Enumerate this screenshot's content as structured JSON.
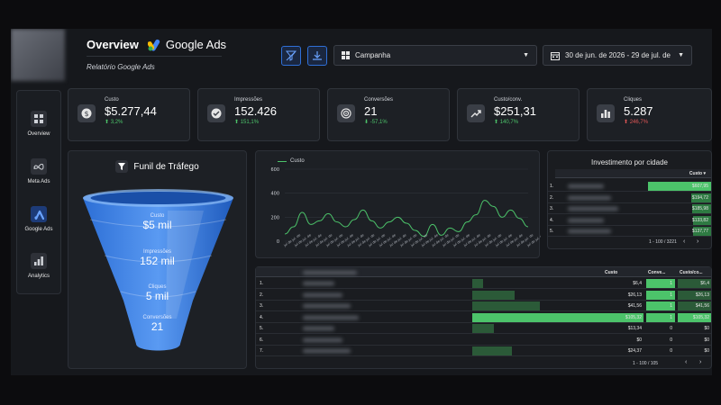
{
  "header": {
    "title": "Overview",
    "brand": "Google Ads",
    "subtitle": "Relatório Google Ads",
    "campaign_dropdown": "Campanha",
    "date_range": "30 de jun. de 2026 - 29 de jul. de 202"
  },
  "sidebar": {
    "items": [
      {
        "label": "Overview",
        "icon": "grid-icon"
      },
      {
        "label": "Meta Ads",
        "icon": "meta-icon"
      },
      {
        "label": "Google Ads",
        "icon": "google-ads-icon"
      },
      {
        "label": "Analytics",
        "icon": "analytics-icon"
      }
    ]
  },
  "kpis": [
    {
      "label": "Custo",
      "value": "$5.277,44",
      "delta": "3,2%",
      "dir": "up",
      "icon": "dollar-icon"
    },
    {
      "label": "Impressões",
      "value": "152.426",
      "delta": "151,1%",
      "dir": "up",
      "icon": "check-icon"
    },
    {
      "label": "Conversões",
      "value": "21",
      "delta": "-57,1%",
      "dir": "down",
      "icon": "target-icon"
    },
    {
      "label": "Custo/conv.",
      "value": "$251,31",
      "delta": "140,7%",
      "dir": "up",
      "icon": "trend-icon"
    },
    {
      "label": "Cliques",
      "value": "5.287",
      "delta": "246,7%",
      "dir": "up",
      "icon": "bar-chart-icon"
    }
  ],
  "funnel": {
    "title": "Funil de Tráfego",
    "stages": [
      {
        "label": "Custo",
        "value": "$5 mil"
      },
      {
        "label": "Impressões",
        "value": "152 mil"
      },
      {
        "label": "Cliques",
        "value": "5 mil"
      },
      {
        "label": "Conversões",
        "value": "21"
      }
    ]
  },
  "chart_data": {
    "type": "line",
    "title": "",
    "xlabel": "",
    "ylabel": "",
    "series": [
      {
        "name": "Custo",
        "values": [
          60,
          120,
          240,
          140,
          170,
          230,
          160,
          120,
          180,
          260,
          170,
          110,
          160,
          200,
          150,
          90,
          40,
          140,
          50,
          110,
          80,
          160,
          220,
          340,
          290,
          200,
          260,
          190,
          120
        ]
      }
    ],
    "yticks": [
      "0",
      "200",
      "400",
      "600"
    ],
    "ylim": [
      0,
      600
    ],
    "x_tick_label": "jul de jul. de",
    "colors": {
      "line": "#4cc36a"
    }
  },
  "city_table": {
    "title": "Investimento por cidade",
    "column": "Custo",
    "rows": [
      {
        "idx": "1.",
        "value": "$607,95"
      },
      {
        "idx": "2.",
        "value": "$194,72"
      },
      {
        "idx": "3.",
        "value": "$185,98"
      },
      {
        "idx": "4.",
        "value": "$133,82"
      },
      {
        "idx": "5.",
        "value": "$137,77"
      }
    ],
    "pager": "1 - 100 / 3221"
  },
  "campaign_table": {
    "columns": [
      "Custo",
      "Conve...",
      "Custo/co..."
    ],
    "rows": [
      {
        "idx": "1.",
        "custo": "$6,4",
        "conv": "1",
        "cpc": "$6,4"
      },
      {
        "idx": "2.",
        "custo": "$26,13",
        "conv": "1",
        "cpc": "$26,13"
      },
      {
        "idx": "3.",
        "custo": "$41,56",
        "conv": "1",
        "cpc": "$41,56"
      },
      {
        "idx": "4.",
        "custo": "$105,32",
        "conv": "1",
        "cpc": "$105,32"
      },
      {
        "idx": "5.",
        "custo": "$13,34",
        "conv": "0",
        "cpc": "$0"
      },
      {
        "idx": "6.",
        "custo": "$0",
        "conv": "0",
        "cpc": "$0"
      },
      {
        "idx": "7.",
        "custo": "$24,37",
        "conv": "0",
        "cpc": "$0"
      }
    ],
    "pager": "1 - 100 / 105"
  }
}
